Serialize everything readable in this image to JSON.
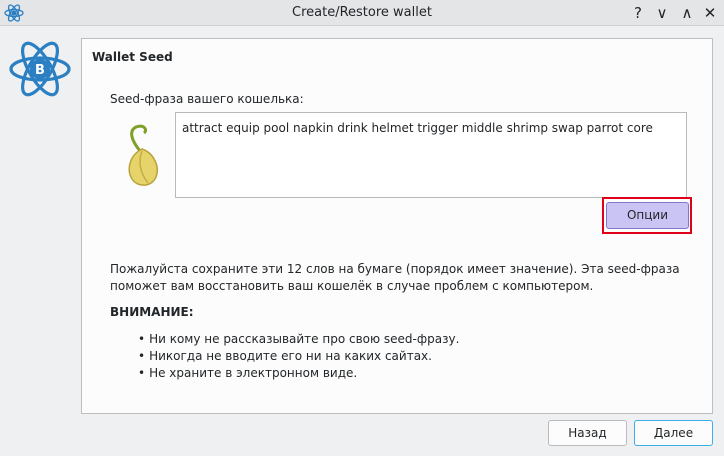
{
  "window": {
    "title": "Create/Restore wallet"
  },
  "titlebar_buttons": {
    "help": "?",
    "minimize": "∨",
    "maximize": "∧",
    "close": "✕"
  },
  "panel": {
    "title": "Wallet Seed"
  },
  "seed": {
    "label": "Seed-фраза вашего кошелька:",
    "words": "attract equip pool napkin drink helmet trigger middle shrimp swap parrot core",
    "options_button": "Опции"
  },
  "info": {
    "text": "Пожалуйста сохраните эти 12 слов на бумаге (порядок имеет значение). Эта seed-фраза поможет вам восстановить ваш кошелёк в случае проблем с компьютером.",
    "warning_title": "ВНИМАНИЕ:",
    "bullets": [
      "Ни кому не рассказывайте про свою seed-фразу.",
      "Никогда не вводите его ни на каких сайтах.",
      "Не храните в электронном виде."
    ]
  },
  "footer": {
    "back": "Назад",
    "next": "Далее"
  },
  "colors": {
    "accent": "#3daee9",
    "options_fill": "#c9c4f4",
    "highlight": "#e0001a",
    "logo_blue": "#2b7fc3"
  }
}
